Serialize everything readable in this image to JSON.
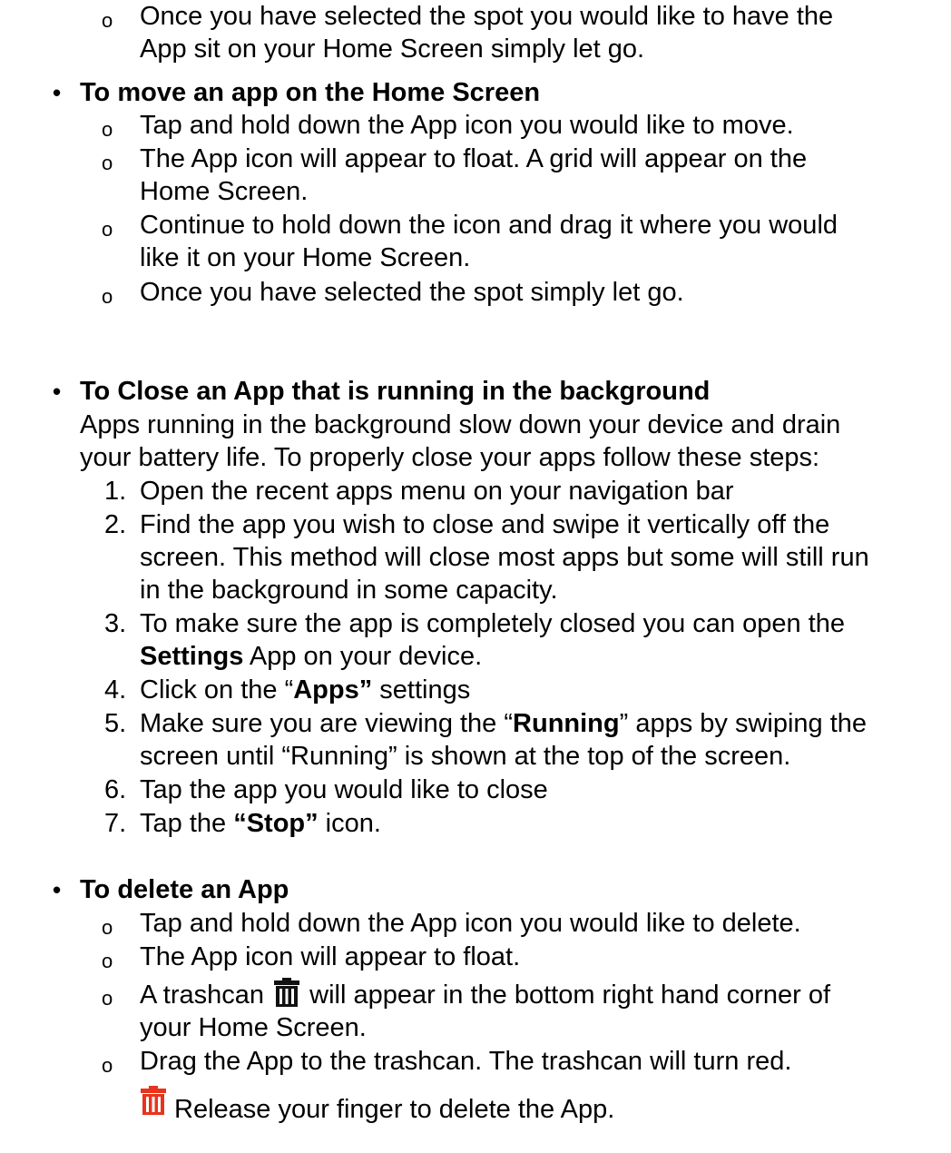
{
  "section0": {
    "items": [
      {
        "line1": "Once you have selected the spot you would like to have the",
        "line2": "App sit on your Home Screen simply let go."
      }
    ]
  },
  "section1": {
    "heading": "To move an app on the Home Screen",
    "items": [
      {
        "line1": "Tap and hold down the App icon you would like to move."
      },
      {
        "line1": "The App icon will appear to float. A grid will appear on the",
        "line2": "Home Screen."
      },
      {
        "line1": "Continue to hold down the icon and drag it where you would",
        "line2": "like it on your Home Screen."
      },
      {
        "line1": "Once you have selected the spot simply let go."
      }
    ]
  },
  "section2": {
    "heading": "To Close an App that is running in the background",
    "intro1": "Apps running in the background slow down your device and drain",
    "intro2": "your battery life. To properly close your apps follow these steps:",
    "steps": [
      {
        "num": "1.",
        "line1": "Open the recent apps menu on your navigation bar"
      },
      {
        "num": "2.",
        "line1": "Find the app you wish to close and swipe it vertically off the",
        "line2": "screen. This method will close most apps but some will still run",
        "line3": "in the background in some capacity."
      },
      {
        "num": "3.",
        "line1": "To make sure the app is completely closed you can open the",
        "line2_bold": "Settings",
        "line2_rest": " App on your device."
      },
      {
        "num": "4.",
        "pre": "Click on the “",
        "bold": "Apps”",
        "post": " settings"
      },
      {
        "num": "5.",
        "pre": "Make sure you are viewing the “",
        "bold": "Running",
        "post": "” apps by swiping the",
        "line2": "screen until “Running” is shown at the top of the screen."
      },
      {
        "num": "6.",
        "line1": "Tap the app you would like to close"
      },
      {
        "num": "7.",
        "pre": "Tap the ",
        "bold": "“Stop”",
        "post": " icon."
      }
    ]
  },
  "section3": {
    "heading": "To delete an App",
    "items": [
      {
        "line1": "Tap and hold down the App icon you would like to delete."
      },
      {
        "line1": "The App icon will appear to float."
      },
      {
        "pre": "A trashcan ",
        "post": " will appear in the bottom right hand corner of",
        "line2": "your Home Screen."
      },
      {
        "line1": "Drag the App to the trashcan. The trashcan will turn red."
      }
    ],
    "release": "Release your finger to delete the App."
  },
  "icons": {
    "bullet": "bullet-dot",
    "sub_bullet": "hollow-circle",
    "trashcan": "trashcan-icon",
    "trashcan_red": "trashcan-red-icon"
  },
  "colors": {
    "text": "#000000",
    "trash_red": "#e8341c",
    "trash_black": "#111111"
  }
}
